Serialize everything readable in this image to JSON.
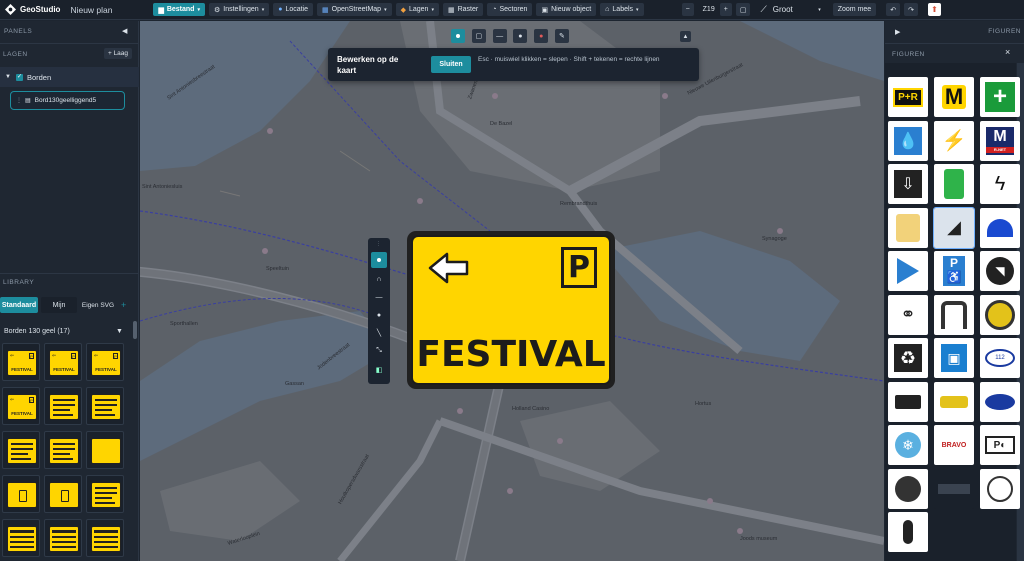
{
  "app": {
    "name": "GeoStudio",
    "plan": "Nieuw plan"
  },
  "toolbar": {
    "file": "Bestand",
    "settings": "Instellingen",
    "location": "Locatie",
    "basemap": "OpenStreetMap",
    "layers": "Lagen",
    "grid": "Raster",
    "sectors": "Sectoren",
    "new_object": "Nieuw object",
    "labels": "Labels",
    "zoom": "Z19",
    "size": "Groot",
    "zoom_more": "Zoom mee"
  },
  "left_panel": {
    "panels_label": "PANELS",
    "layers_label": "LAGEN",
    "add_layer": "+ Laag",
    "group": "Borden",
    "item": "Bord130geelliggend5",
    "library_label": "LIBRARY",
    "tabs": [
      "Standaard",
      "Mijn",
      "Eigen SVG"
    ],
    "category": "Borden 130 geel (17)",
    "thumb_label": "FESTIVAL"
  },
  "edit_banner": {
    "title": "Bewerken op de kaart",
    "close": "Sluiten",
    "hint": "Esc · muiswiel klikken = slepen · Shift + tekenen = rechte lijnen"
  },
  "sign": {
    "text": "FESTIVAL",
    "symbol": "P",
    "color": "#ffd500"
  },
  "map_labels": [
    "Sint Antoniesluis",
    "Jodenbreestraat",
    "Nieuwe Uilenburgerstraat",
    "Waterlooplein",
    "Houtkopersdwarsstraat",
    "Zwanenburgwal",
    "Sint Antoniesbreestraat",
    "Rembrandthuis",
    "Gassan",
    "Holland Casino",
    "Sporthallen",
    "Speeltuin",
    "De Bazel",
    "Hortus",
    "Joods museum",
    "Synagoge"
  ],
  "right_panel": {
    "figures_label": "FIGUREN",
    "section": "FIGUREN",
    "icons": [
      "pr-icon",
      "metro-logo-icon",
      "first-aid-icon",
      "water-drop-icon",
      "antenna-icon",
      "metro-m-icon",
      "download-icon",
      "vest-icon",
      "lightning-icon",
      "backpack-icon",
      "camera-icon",
      "siren-icon",
      "play-arrow-icon",
      "disabled-parking-icon",
      "cctv-icon",
      "bicycle-icon",
      "arch-icon",
      "wheel-icon",
      "recycle-icon",
      "bus-icon",
      "ambulance-badge-icon",
      "truck-icon",
      "police-car-icon",
      "police-badge-icon",
      "snowflake-icon",
      "bravo-icon",
      "parking-car-icon",
      "ev-charger-icon",
      "barrier-icon",
      "helmet-icon",
      "footprint-icon"
    ],
    "metro_badge": "M",
    "metro_sub": "R-NET",
    "bravo": "BRAVO",
    "police_text": "112"
  },
  "colors": {
    "accent": "#1d8d9e",
    "sign_yellow": "#ffd500"
  }
}
